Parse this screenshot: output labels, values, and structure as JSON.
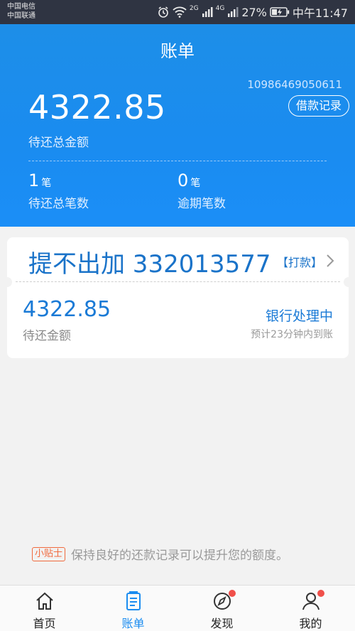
{
  "status_bar": {
    "carrier_1": "中国电信",
    "carrier_2": "中国联通",
    "net_1": "2G",
    "net_2": "4G",
    "battery": "27%",
    "time": "中午11:47"
  },
  "header": {
    "title": "账单",
    "account_number": "10986469050611",
    "loan_record_button": "借款记录",
    "total_amount": "4322.85",
    "total_label": "待还总金额",
    "pending_count": "1",
    "pending_unit": "笔",
    "pending_label": "待还总笔数",
    "overdue_count": "0",
    "overdue_unit": "笔",
    "overdue_label": "逾期笔数"
  },
  "card": {
    "title": "提不出加 332013577",
    "tag": "【打款】",
    "amount": "4322.85",
    "amount_label": "待还金额",
    "status": "银行处理中",
    "eta": "预计23分钟内到账"
  },
  "tip": {
    "badge": "小贴士",
    "text": "保持良好的还款记录可以提升您的额度。"
  },
  "nav": {
    "items": [
      {
        "label": "首页",
        "icon": "home-icon",
        "active": false
      },
      {
        "label": "账单",
        "icon": "bill-icon",
        "active": true
      },
      {
        "label": "发现",
        "icon": "compass-icon",
        "active": false
      },
      {
        "label": "我的",
        "icon": "user-icon",
        "active": false
      }
    ]
  },
  "colors": {
    "primary": "#1a8cf0",
    "status_bar": "#2f3442",
    "accent_text": "#1a73c9",
    "tip_badge": "#f06a3d",
    "notification_dot": "#f0504a"
  }
}
